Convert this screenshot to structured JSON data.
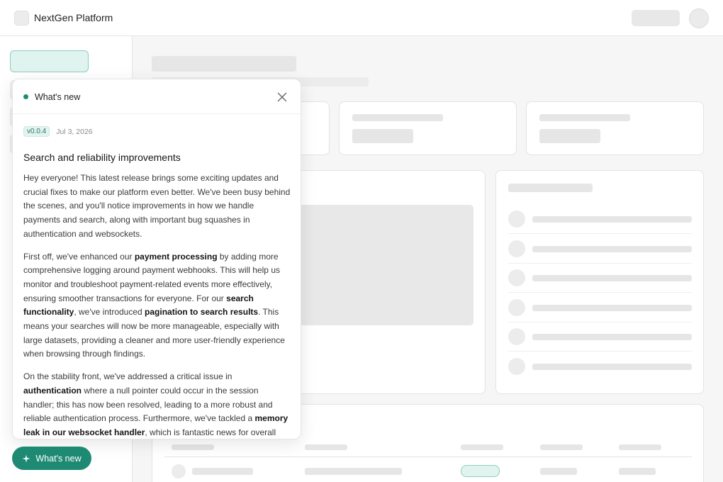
{
  "app": {
    "title": "NextGen Platform"
  },
  "panel": {
    "title": "What's new",
    "version": "v0.0.4",
    "date": "Jul 3, 2026",
    "headline": "Search and reliability improvements",
    "p1": "Hey everyone! This latest release brings some exciting updates and crucial fixes to make our platform even better. We've been busy behind the scenes, and you'll notice improvements in how we handle payments and search, along with important bug squashes in authentication and websockets.",
    "p2": {
      "a": "First off, we've enhanced our ",
      "b1": "payment processing",
      "c": " by adding more comprehensive logging around payment webhooks. This will help us monitor and troubleshoot payment-related events more effectively, ensuring smoother transactions for everyone. For our ",
      "b2": "search functionality",
      "d": ", we've introduced ",
      "b3": "pagination to search results",
      "e": ". This means your searches will now be more manageable, especially with large datasets, providing a cleaner and more user-friendly experience when browsing through findings."
    },
    "p3": {
      "a": "On the stability front, we've addressed a critical issue in ",
      "b1": "authentication",
      "c": " where a null pointer could occur in the session handler; this has now been resolved, leading to a more robust and reliable authentication process. Furthermore, we've tackled a ",
      "b2": "memory leak in our websocket handler",
      "d": ", which is fantastic news for overall system performance and stability, especially under heavy load."
    }
  },
  "fab": {
    "label": "What's new"
  },
  "colors": {
    "accent": "#1f8a74",
    "accent_soft": "#dff3ef"
  },
  "icons": {
    "close": "close-icon",
    "sparkle": "sparkle-icon"
  }
}
